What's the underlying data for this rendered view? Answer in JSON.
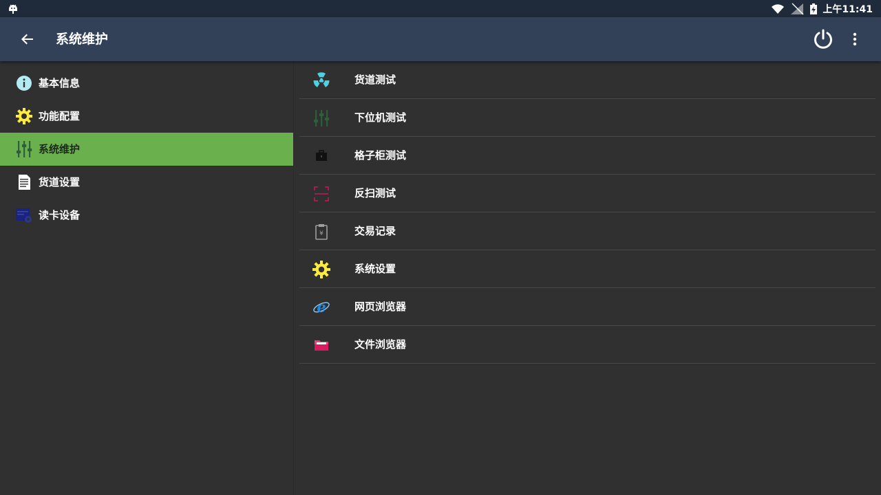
{
  "status_bar": {
    "time": "上午11:41",
    "icons": [
      "android-debug-icon",
      "wifi-icon",
      "signal-off-icon",
      "battery-charging-icon"
    ]
  },
  "app_bar": {
    "title": "系统维护",
    "icons": [
      "back-arrow-icon",
      "power-icon",
      "more-vert-icon"
    ]
  },
  "sidebar": {
    "items": [
      {
        "label": "基本信息",
        "icon": "info-icon",
        "color": "#b2ebf2"
      },
      {
        "label": "功能配置",
        "icon": "gear-icon",
        "color": "#ffeb3b"
      },
      {
        "label": "系统维护",
        "icon": "sliders-icon",
        "color": "#2e5e3a",
        "active": true
      },
      {
        "label": "货道设置",
        "icon": "document-icon",
        "color": "#ffffff"
      },
      {
        "label": "读卡设备",
        "icon": "card-reader-icon",
        "color": "#1a237e"
      }
    ],
    "active_color": "#6ab04c"
  },
  "content": {
    "items": [
      {
        "label": "货道测试",
        "icon": "radiation-icon",
        "color": "#4dd0e1"
      },
      {
        "label": "下位机测试",
        "icon": "sliders-icon",
        "color": "#2e5e3a"
      },
      {
        "label": "格子柜测试",
        "icon": "briefcase-icon",
        "color": "#111111"
      },
      {
        "label": "反扫测试",
        "icon": "scan-frame-icon",
        "color": "#c2185b"
      },
      {
        "label": "交易记录",
        "icon": "clipboard-yen-icon",
        "color": "#9e9e9e"
      },
      {
        "label": "系统设置",
        "icon": "gear-icon",
        "color": "#ffeb3b"
      },
      {
        "label": "网页浏览器",
        "icon": "ie-browser-icon",
        "color": "#1e88e5"
      },
      {
        "label": "文件浏览器",
        "icon": "folder-icon",
        "color": "#ec407a"
      }
    ]
  }
}
